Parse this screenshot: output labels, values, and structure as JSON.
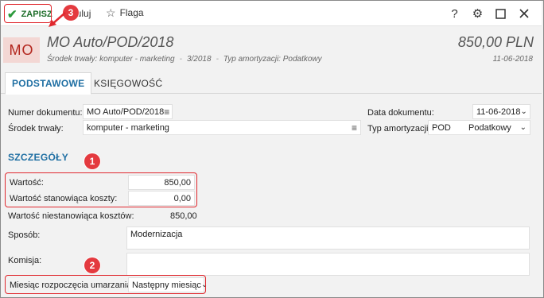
{
  "toolbar": {
    "save_label": "ZAPISZ",
    "cancel_label": "nuluj",
    "flag_label": "Flaga"
  },
  "header": {
    "avatar_initials": "MO",
    "title": "MO Auto/POD/2018",
    "subtitle_asset": "Środek trwały: komputer - marketing",
    "subtitle_number": "3/2018",
    "subtitle_amortization": "Typ amortyzacji: Podatkowy",
    "amount": "850,00 PLN",
    "date": "11-06-2018"
  },
  "tabs": [
    {
      "label": "PODSTAWOWE",
      "active": true
    },
    {
      "label": "KSIĘGOWOŚĆ",
      "active": false
    }
  ],
  "form": {
    "doc_number_label": "Numer dokumentu:",
    "doc_number_value": "MO Auto/POD/2018",
    "asset_label": "Środek trwały:",
    "asset_value": "komputer - marketing",
    "doc_date_label": "Data dokumentu:",
    "doc_date_value": "11-06-2018",
    "amort_type_label": "Typ amortyzacji:",
    "amort_type_code": "POD",
    "amort_type_value": "Podatkowy"
  },
  "details": {
    "section_title": "SZCZEGÓŁY",
    "value_label": "Wartość:",
    "value_value": "850,00",
    "cost_value_label": "Wartość stanowiąca koszty:",
    "cost_value_value": "0,00",
    "noncost_value_label": "Wartość niestanowiąca kosztów:",
    "noncost_value_value": "850,00",
    "method_label": "Sposób:",
    "method_value": "Modernizacja",
    "commission_label": "Komisja:",
    "commission_value": "",
    "depreciation_start_label": "Miesiąc rozpoczęcia umarzania:",
    "depreciation_start_value": "Następny miesiąc"
  },
  "annotations": {
    "badge1": "1",
    "badge2": "2",
    "badge3": "3",
    "color": "#e0282e"
  },
  "colors": {
    "accent": "#1f6fa3",
    "save_green": "#2c9a3c",
    "avatar_bg": "#f3d7d4",
    "avatar_text": "#b3261e"
  }
}
